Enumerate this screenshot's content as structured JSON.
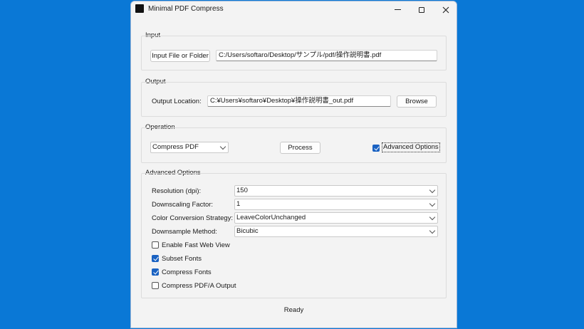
{
  "window": {
    "title": "Minimal PDF Compress"
  },
  "input_group": {
    "title": "Input",
    "button_label": "Input File or Folder",
    "path_value": "C:/Users/softaro/Desktop/サンプル/pdf/操作説明書.pdf"
  },
  "output_group": {
    "title": "Output",
    "location_label": "Output Location:",
    "location_value": "C:¥Users¥softaro¥Desktop¥操作説明書_out.pdf",
    "browse_label": "Browse"
  },
  "operation_group": {
    "title": "Operation",
    "operation_selected": "Compress PDF",
    "process_label": "Process",
    "advanced_checkbox_label": "Advanced Options",
    "advanced_checked": true
  },
  "advanced_group": {
    "title": "Advanced Options",
    "settings": [
      {
        "label": "Resolution (dpi):",
        "value": "150"
      },
      {
        "label": "Downscaling Factor:",
        "value": "1"
      },
      {
        "label": "Color Conversion Strategy:",
        "value": "LeaveColorUnchanged"
      },
      {
        "label": "Downsample Method:",
        "value": "Bicubic"
      }
    ],
    "options": [
      {
        "label": "Enable Fast Web View",
        "checked": false
      },
      {
        "label": "Subset Fonts",
        "checked": true
      },
      {
        "label": "Compress Fonts",
        "checked": true
      },
      {
        "label": "Compress PDF/A Output",
        "checked": false
      }
    ]
  },
  "status": {
    "text": "Ready"
  },
  "colors": {
    "desktop": "#0a78d6",
    "accent": "#1a62c2",
    "window_bg": "#f3f3f3"
  }
}
